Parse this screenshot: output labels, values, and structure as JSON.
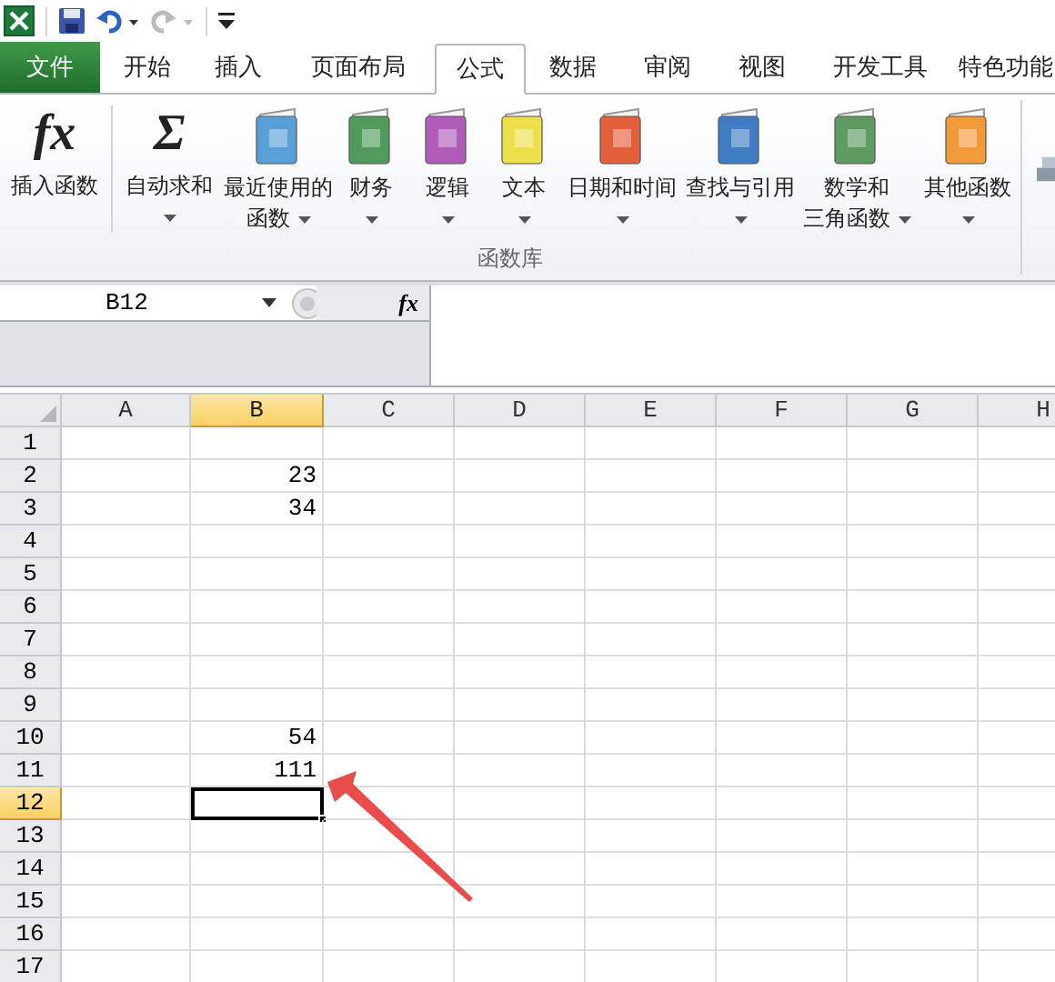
{
  "tabs": [
    {
      "label": "文件",
      "kind": "file",
      "selected": false
    },
    {
      "label": "开始",
      "kind": "tab",
      "selected": false
    },
    {
      "label": "插入",
      "kind": "tab",
      "selected": false
    },
    {
      "label": "页面布局",
      "kind": "tab",
      "selected": false
    },
    {
      "label": "公式",
      "kind": "tab",
      "selected": true
    },
    {
      "label": "数据",
      "kind": "tab",
      "selected": false
    },
    {
      "label": "审阅",
      "kind": "tab",
      "selected": false
    },
    {
      "label": "视图",
      "kind": "tab",
      "selected": false
    },
    {
      "label": "开发工具",
      "kind": "tab",
      "selected": false
    },
    {
      "label": "特色功能",
      "kind": "tab",
      "selected": false
    }
  ],
  "ribbon": {
    "buttons": [
      {
        "kind": "glyph",
        "glyph": "fx",
        "lines": [
          "插入函数"
        ],
        "dropdown": false
      },
      {
        "kind": "glyph",
        "glyph": "Σ",
        "lines": [
          "自动求和"
        ],
        "dropdown": true
      },
      {
        "kind": "book",
        "color": "#5aa0d8",
        "lines": [
          "最近使用的",
          "函数"
        ],
        "dropdown": true
      },
      {
        "kind": "book",
        "color": "#4f9a5c",
        "lines": [
          "财务"
        ],
        "dropdown": true
      },
      {
        "kind": "book",
        "color": "#b05cb8",
        "lines": [
          "逻辑"
        ],
        "dropdown": true
      },
      {
        "kind": "book",
        "color": "#ede04a",
        "lines": [
          "文本"
        ],
        "dropdown": true
      },
      {
        "kind": "book",
        "color": "#e2603a",
        "lines": [
          "日期和时间"
        ],
        "dropdown": true
      },
      {
        "kind": "book",
        "color": "#3f7cc4",
        "lines": [
          "查找与引用"
        ],
        "dropdown": true
      },
      {
        "kind": "book",
        "color": "#5e9a62",
        "lines": [
          "数学和",
          "三角函数"
        ],
        "dropdown": true
      },
      {
        "kind": "book",
        "color": "#f39a3a",
        "lines": [
          "其他函数"
        ],
        "dropdown": true
      }
    ],
    "group_label": "函数库"
  },
  "name_box": "B12",
  "formula_glyph": "fx",
  "columns": [
    {
      "label": "A",
      "selected": false
    },
    {
      "label": "B",
      "selected": true
    },
    {
      "label": "C",
      "selected": false
    },
    {
      "label": "D",
      "selected": false
    },
    {
      "label": "E",
      "selected": false
    },
    {
      "label": "F",
      "selected": false
    },
    {
      "label": "G",
      "selected": false
    },
    {
      "label": "H",
      "selected": false
    }
  ],
  "rows": [
    {
      "label": "1",
      "selected": false
    },
    {
      "label": "2",
      "selected": false,
      "cells": {
        "B": "23"
      }
    },
    {
      "label": "3",
      "selected": false,
      "cells": {
        "B": "34"
      }
    },
    {
      "label": "4",
      "selected": false
    },
    {
      "label": "5",
      "selected": false
    },
    {
      "label": "6",
      "selected": false
    },
    {
      "label": "7",
      "selected": false
    },
    {
      "label": "8",
      "selected": false
    },
    {
      "label": "9",
      "selected": false
    },
    {
      "label": "10",
      "selected": false,
      "cells": {
        "B": "54"
      }
    },
    {
      "label": "11",
      "selected": false,
      "cells": {
        "B": "111"
      }
    },
    {
      "label": "12",
      "selected": true
    },
    {
      "label": "13",
      "selected": false
    },
    {
      "label": "14",
      "selected": false
    },
    {
      "label": "15",
      "selected": false
    },
    {
      "label": "16",
      "selected": false
    },
    {
      "label": "17",
      "selected": false
    }
  ]
}
